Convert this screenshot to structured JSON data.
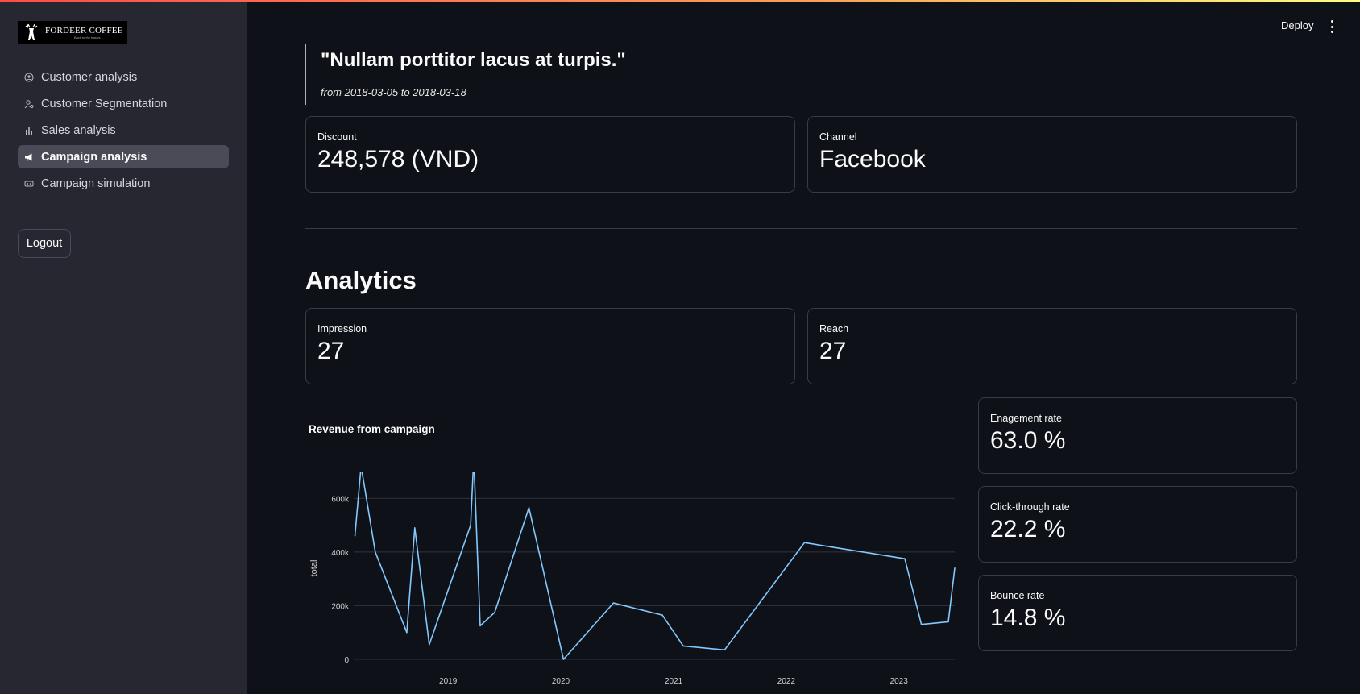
{
  "sidebar": {
    "logo": {
      "brand": "FORDEER COFFEE",
      "tagline": "Back to the basics"
    },
    "items": [
      {
        "label": "Customer analysis",
        "icon": "user-circle-icon",
        "active": false
      },
      {
        "label": "Customer Segmentation",
        "icon": "segmentation-icon",
        "active": false
      },
      {
        "label": "Sales analysis",
        "icon": "bar-chart-icon",
        "active": false
      },
      {
        "label": "Campaign analysis",
        "icon": "megaphone-icon",
        "active": true
      },
      {
        "label": "Campaign simulation",
        "icon": "simulation-icon",
        "active": false
      }
    ],
    "logout_label": "Logout"
  },
  "header": {
    "deploy_label": "Deploy",
    "menu_icon": "kebab-menu-icon"
  },
  "campaign": {
    "title": "\"Nullam porttitor lacus at turpis.\"",
    "date_range": "from 2018-03-05 to 2018-03-18"
  },
  "metrics_top": {
    "discount": {
      "label": "Discount",
      "value": "248,578 (VND)"
    },
    "channel": {
      "label": "Channel",
      "value": "Facebook"
    }
  },
  "analytics": {
    "title": "Analytics",
    "impression": {
      "label": "Impression",
      "value": "27"
    },
    "reach": {
      "label": "Reach",
      "value": "27"
    },
    "engagement": {
      "label": "Enagement rate",
      "value": "63.0 %"
    },
    "ctr": {
      "label": "Click-through rate",
      "value": "22.2 %"
    },
    "bounce": {
      "label": "Bounce rate",
      "value": "14.8 %"
    }
  },
  "colors": {
    "line": "#83c9ff",
    "background": "#0e1117",
    "sidebar": "#262730",
    "accent": "#ff4b4b"
  },
  "chart_data": {
    "type": "line",
    "title": "Revenue from campaign",
    "xlabel": "",
    "ylabel": "total",
    "ylim": [
      0,
      700000
    ],
    "yticks": [
      0,
      200000,
      400000,
      600000
    ],
    "ytick_labels": [
      "0",
      "200k",
      "400k",
      "600k"
    ],
    "xticks": [
      "2019",
      "2020",
      "2021",
      "2022",
      "2023"
    ],
    "x_is_date": true,
    "xlim": [
      "2018-03-01",
      "2023-07-01"
    ],
    "grid": true,
    "series": [
      {
        "color": "#83c9ff",
        "points": [
          {
            "x": "2018-03-05",
            "y": 460000
          },
          {
            "x": "2018-03-25",
            "y": 720000
          },
          {
            "x": "2018-05-10",
            "y": 400000
          },
          {
            "x": "2018-08-20",
            "y": 100000
          },
          {
            "x": "2018-09-15",
            "y": 490000
          },
          {
            "x": "2018-11-01",
            "y": 55000
          },
          {
            "x": "2019-03-15",
            "y": 500000
          },
          {
            "x": "2019-03-25",
            "y": 750000
          },
          {
            "x": "2019-04-15",
            "y": 125000
          },
          {
            "x": "2019-06-01",
            "y": 175000
          },
          {
            "x": "2019-09-20",
            "y": 565000
          },
          {
            "x": "2020-01-10",
            "y": 0
          },
          {
            "x": "2020-06-20",
            "y": 210000
          },
          {
            "x": "2020-11-25",
            "y": 165000
          },
          {
            "x": "2021-02-01",
            "y": 50000
          },
          {
            "x": "2021-06-15",
            "y": 35000
          },
          {
            "x": "2022-03-01",
            "y": 435000
          },
          {
            "x": "2023-01-20",
            "y": 375000
          },
          {
            "x": "2023-03-15",
            "y": 130000
          },
          {
            "x": "2023-06-10",
            "y": 140000
          },
          {
            "x": "2023-07-01",
            "y": 340000
          }
        ]
      }
    ]
  }
}
